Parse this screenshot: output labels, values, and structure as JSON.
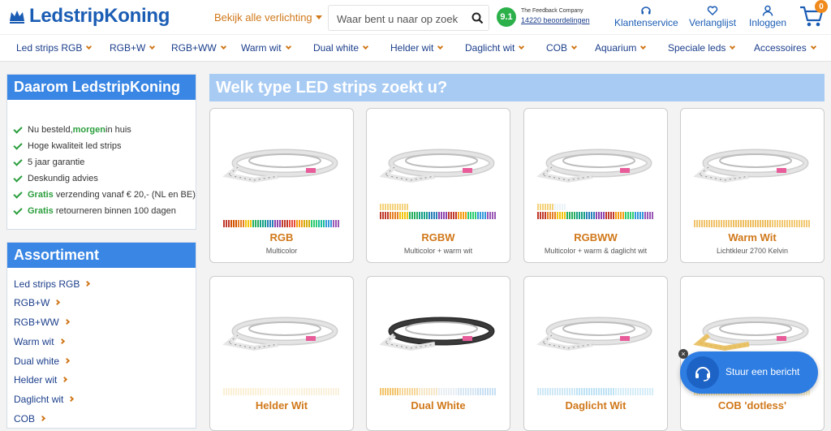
{
  "header": {
    "logo_text": "LedstripKoning",
    "all_lighting": "Bekijk alle verlichting",
    "search_placeholder": "Waar bent u naar op zoek?",
    "rating_score": "9.1",
    "rating_source": "The Feedback Company",
    "rating_count": "14220 beoordelingen",
    "customer_service": "Klantenservice",
    "wishlist": "Verlanglijst",
    "login": "Inloggen",
    "cart_count": "0"
  },
  "menu": [
    "Led strips RGB",
    "RGB+W",
    "RGB+WW",
    "Warm wit",
    "Dual white",
    "Helder wit",
    "Daglicht wit",
    "COB",
    "Aquarium",
    "Speciale leds",
    "Accessoires"
  ],
  "why_box": {
    "title": "Daarom LedstripKoning",
    "items": [
      {
        "pre": "Nu besteld, ",
        "bold": "morgen",
        "post": " in huis"
      },
      {
        "pre": "Hoge kwaliteit led strips",
        "bold": "",
        "post": ""
      },
      {
        "pre": "5 jaar garantie",
        "bold": "",
        "post": ""
      },
      {
        "pre": "Deskundig advies",
        "bold": "",
        "post": ""
      },
      {
        "pre": "",
        "bold": "Gratis",
        "post": " verzending vanaf € 20,- (NL en BE)"
      },
      {
        "pre": "",
        "bold": "Gratis",
        "post": " retourneren binnen 100 dagen"
      }
    ]
  },
  "assortment": {
    "title": "Assortiment",
    "items": [
      "Led strips RGB",
      "RGB+W",
      "RGB+WW",
      "Warm wit",
      "Dual white",
      "Helder wit",
      "Daglicht wit",
      "COB"
    ]
  },
  "main_title": "Welk type LED strips zoekt u?",
  "products": [
    {
      "title": "RGB",
      "subtitle": "Multicolor",
      "bar": "rgb"
    },
    {
      "title": "RGBW",
      "subtitle": "Multicolor + warm wit",
      "bar": "rgbw"
    },
    {
      "title": "RGBWW",
      "subtitle": "Multicolor + warm & daglicht wit",
      "bar": "rgbww"
    },
    {
      "title": "Warm Wit",
      "subtitle": "Lichtkleur 2700 Kelvin",
      "bar": "warm"
    },
    {
      "title": "Helder Wit",
      "subtitle": "",
      "bar": "helder"
    },
    {
      "title": "Dual White",
      "subtitle": "",
      "bar": "dual"
    },
    {
      "title": "Daglicht Wit",
      "subtitle": "",
      "bar": "daglicht"
    },
    {
      "title": "COB 'dotless'",
      "subtitle": "",
      "bar": "cob"
    }
  ],
  "chat": {
    "label": "Stuur een bericht",
    "close": "×"
  },
  "colors": {
    "brand_blue": "#1b5db4",
    "accent_orange": "#d0781a",
    "box_blue": "#3a86e4",
    "check_green": "#2a9e3c",
    "rating_green": "#2bb04a"
  }
}
